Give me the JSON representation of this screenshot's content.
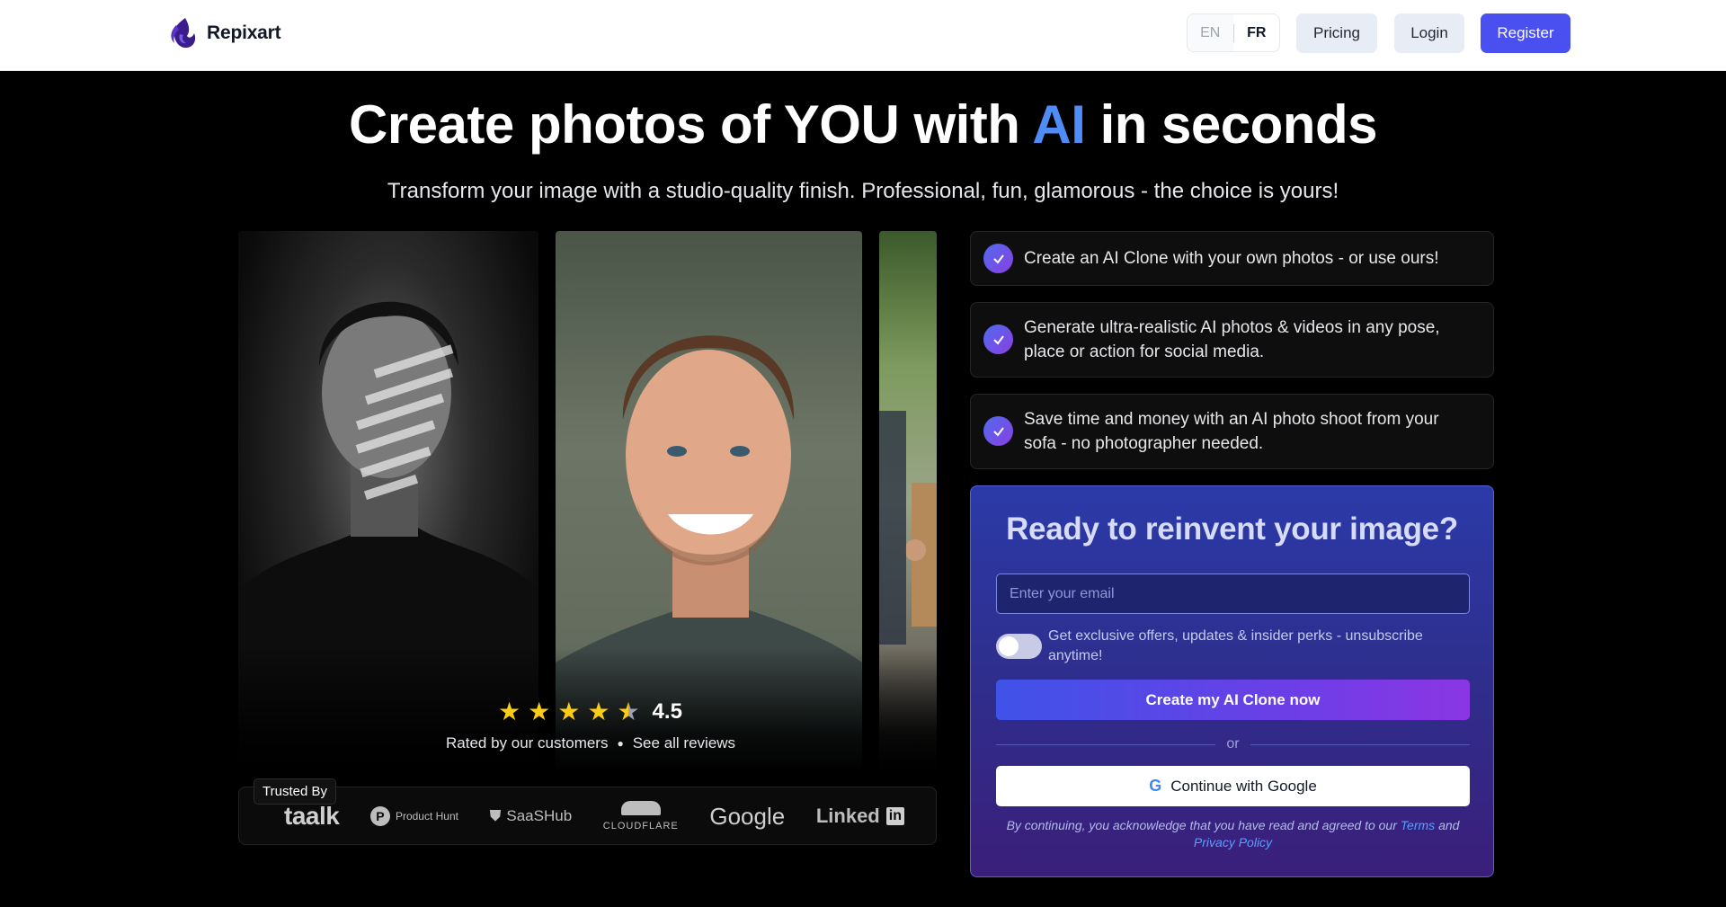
{
  "header": {
    "brand": "Repixart",
    "lang_en": "EN",
    "lang_fr": "FR",
    "pricing": "Pricing",
    "login": "Login",
    "register": "Register"
  },
  "hero": {
    "title_before": "Create photos of YOU with",
    "title_ai": "AI",
    "title_after": "in seconds",
    "subtitle": "Transform your image with a studio-quality finish. Professional, fun, glamorous - the choice is yours!"
  },
  "rating": {
    "stars": 4.5,
    "value": "4.5",
    "rated_by": "Rated by our customers",
    "see_reviews": "See all reviews"
  },
  "trusted": {
    "label": "Trusted By",
    "logos": [
      "taalk",
      "Product Hunt",
      "SaaSHub",
      "CLOUDFLARE",
      "Google",
      "Linked",
      "in"
    ]
  },
  "features": [
    "Create an AI Clone with your own photos - or use ours!",
    "Generate ultra-realistic AI photos & videos in any pose, place or action for social media.",
    "Save time and money with an AI photo shoot from your sofa - no photographer needed."
  ],
  "signup": {
    "title": "Ready to reinvent your image?",
    "email_placeholder": "Enter your email",
    "optin": "Get exclusive offers, updates & insider perks - unsubscribe anytime!",
    "cta": "Create my AI Clone now",
    "or": "or",
    "google": "Continue with Google",
    "legal_prefix": "By continuing, you acknowledge that you have read and agreed to our",
    "terms": "Terms",
    "and": "and",
    "privacy": "Privacy Policy"
  },
  "colors": {
    "accent": "#4a4ff0",
    "ai_highlight": "#4f8cf7",
    "star": "#facc15"
  }
}
